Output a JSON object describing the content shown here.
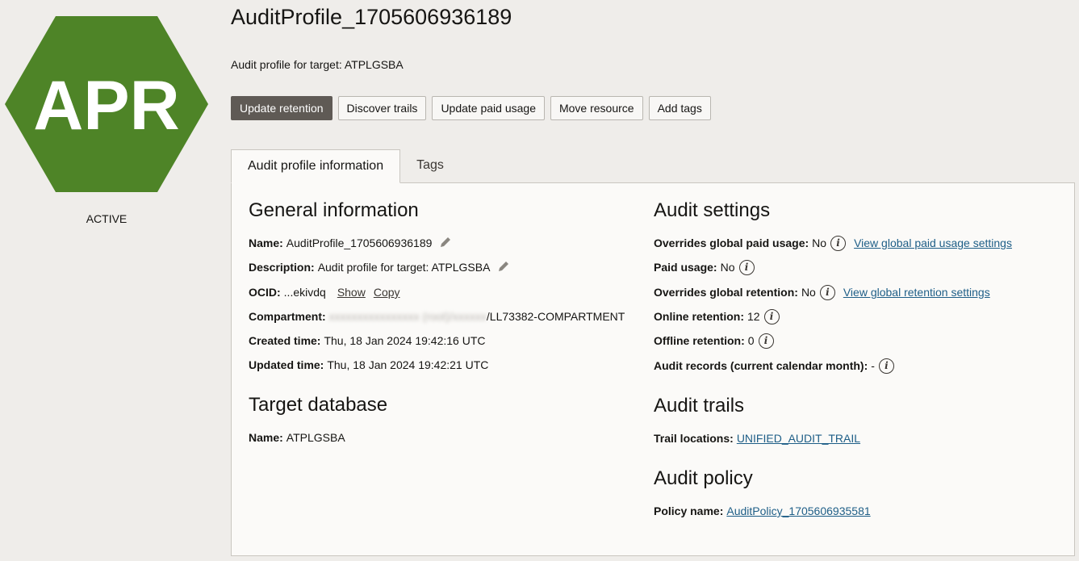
{
  "badge": {
    "text": "APR",
    "color": "#4e8427"
  },
  "status": "ACTIVE",
  "header": {
    "title": "AuditProfile_1705606936189",
    "subtitle": "Audit profile for target: ATPLGSBA"
  },
  "actions": {
    "update_retention": "Update retention",
    "discover_trails": "Discover trails",
    "update_paid_usage": "Update paid usage",
    "move_resource": "Move resource",
    "add_tags": "Add tags"
  },
  "tabs": {
    "info": "Audit profile information",
    "tags": "Tags"
  },
  "general": {
    "heading": "General information",
    "name_label": "Name:",
    "name_value": "AuditProfile_1705606936189",
    "description_label": "Description:",
    "description_value": "Audit profile for target: ATPLGSBA",
    "ocid_label": "OCID:",
    "ocid_value": "...ekivdq",
    "show_link": "Show",
    "copy_link": "Copy",
    "compartment_label": "Compartment:",
    "compartment_blurred": "xxxxxxxxxxxxxxxx (root)/xxxxxx",
    "compartment_value": "/LL73382-COMPARTMENT",
    "created_label": "Created time:",
    "created_value": "Thu, 18 Jan 2024 19:42:16 UTC",
    "updated_label": "Updated time:",
    "updated_value": "Thu, 18 Jan 2024 19:42:21 UTC"
  },
  "target": {
    "heading": "Target database",
    "name_label": "Name:",
    "name_value": "ATPLGSBA"
  },
  "audit_settings": {
    "heading": "Audit settings",
    "overrides_paid_label": "Overrides global paid usage:",
    "overrides_paid_value": "No",
    "view_paid_link": "View global paid usage settings",
    "paid_usage_label": "Paid usage:",
    "paid_usage_value": "No",
    "overrides_retention_label": "Overrides global retention:",
    "overrides_retention_value": "No",
    "view_retention_link": "View global retention settings",
    "online_label": "Online retention:",
    "online_value": "12",
    "offline_label": "Offline retention:",
    "offline_value": "0",
    "records_label": "Audit records (current calendar month):",
    "records_value": "-"
  },
  "audit_trails": {
    "heading": "Audit trails",
    "locations_label": "Trail locations:",
    "locations_value": "UNIFIED_AUDIT_TRAIL"
  },
  "audit_policy": {
    "heading": "Audit policy",
    "policy_label": "Policy name:",
    "policy_value": "AuditPolicy_1705606935581"
  },
  "icons": {
    "edit": "pencil-icon",
    "info": "info-icon"
  }
}
